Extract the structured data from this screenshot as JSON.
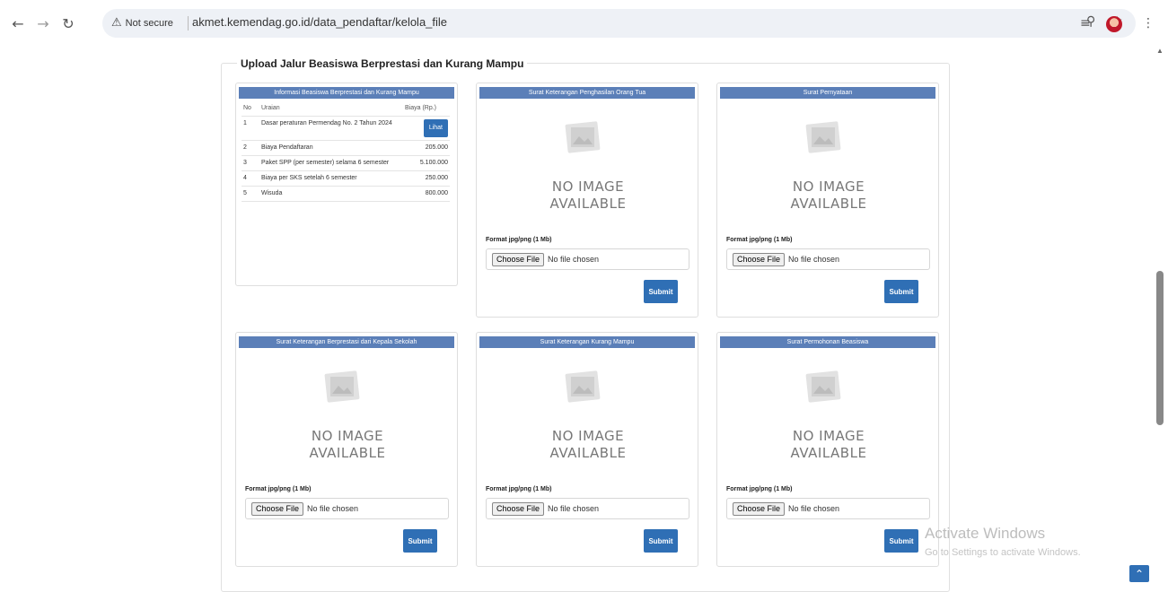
{
  "browser": {
    "security_label": "Not secure",
    "url": "akmet.kemendag.go.id/data_pendaftar/kelola_file"
  },
  "page": {
    "legend": "Upload Jalur Beasiswa Berprestasi dan Kurang Mampu"
  },
  "info_panel": {
    "title": "Informasi Beasiswa Berprestasi dan Kurang Mampu",
    "headers": {
      "no": "No",
      "uraian": "Uraian",
      "biaya": "Biaya (Rp.)"
    },
    "rows": [
      {
        "no": "1",
        "uraian": "Dasar peraturan Permendag No. 2 Tahun 2024",
        "biaya": "",
        "button": "Lihat"
      },
      {
        "no": "2",
        "uraian": "Biaya Pendaftaran",
        "biaya": "205.000"
      },
      {
        "no": "3",
        "uraian": "Paket SPP (per semester) selama 6 semester",
        "biaya": "5.100.000"
      },
      {
        "no": "4",
        "uraian": "Biaya per SKS setelah 6 semester",
        "biaya": "250.000"
      },
      {
        "no": "5",
        "uraian": "Wisuda",
        "biaya": "800.000"
      }
    ]
  },
  "upload_panels": [
    {
      "title": "Surat Keterangan Penghasilan Orang Tua"
    },
    {
      "title": "Surat Pernyataan"
    },
    {
      "title": "Surat Keterangan Berprestasi dari Kepala Sekolah"
    },
    {
      "title": "Surat Keterangan Kurang Mampu"
    },
    {
      "title": "Surat Permohonan Beasiswa"
    }
  ],
  "upload_common": {
    "no_image_line1": "NO IMAGE",
    "no_image_line2": "AVAILABLE",
    "format_label": "Format jpg/png (1 Mb)",
    "choose_file": "Choose File",
    "no_file": "No file chosen",
    "submit": "Submit"
  },
  "watermark": {
    "line1": "Activate Windows",
    "line2": "Go to Settings to activate Windows."
  },
  "icons": [
    "back-arrow-icon",
    "forward-arrow-icon",
    "reload-icon",
    "warning-icon",
    "zoom-icon",
    "star-icon",
    "reading-list-icon",
    "kebab-menu-icon"
  ]
}
